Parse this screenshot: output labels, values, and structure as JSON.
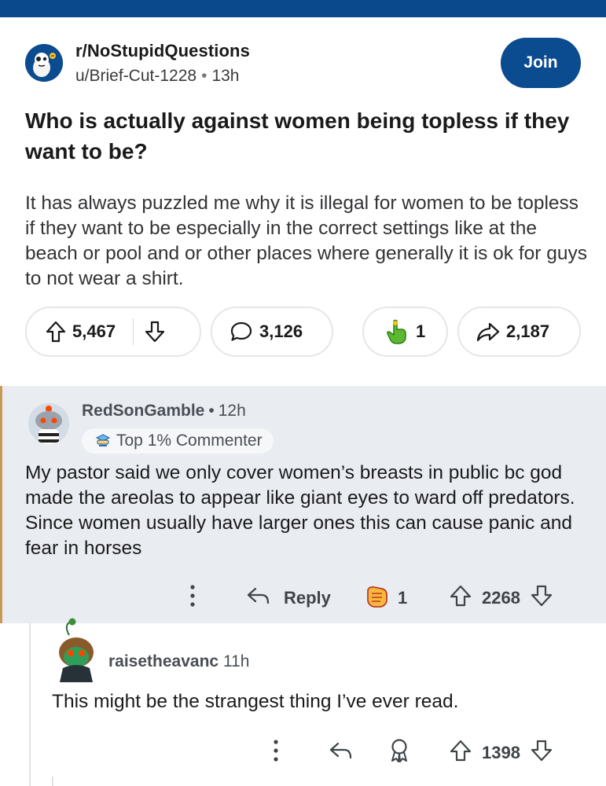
{
  "post": {
    "subreddit": "r/NoStupidQuestions",
    "author": "u/Brief-Cut-1228",
    "age": "13h",
    "join_label": "Join",
    "title": "Who is actually against women being topless if they want to be?",
    "body": "It has always puzzled me why it is illegal for women to be topless if they want to be especially in the correct settings like at the beach or pool and or other places where generally it is ok for guys to not wear a shirt.",
    "upvotes": "5,467",
    "comments": "3,126",
    "awards": "1",
    "shares": "2,187"
  },
  "comments": [
    {
      "username": "RedSonGamble",
      "age": "12h",
      "badge": "Top 1% Commenter",
      "text": "My pastor said we only cover women’s breasts in public bc god made the areolas to appear like giant eyes to ward off predators. Since women usually have larger ones this can cause panic and fear in horses",
      "reply_label": "Reply",
      "awards": "1",
      "score": "2268"
    },
    {
      "username": "raisetheavanc",
      "age": "11h",
      "text": "This might be the strangest thing I’ve ever read.",
      "score": "1398"
    }
  ],
  "icons": {
    "upvote": "arrow-up-icon",
    "downvote": "arrow-down-icon",
    "comment": "speech-bubble-icon",
    "award": "hand-award-icon",
    "share": "share-arrow-icon",
    "more": "vertical-dots-icon",
    "reply": "reply-arrow-icon"
  },
  "colors": {
    "brand": "#0b4b8f",
    "comment_highlight": "#e9edf2",
    "highlight_bar": "#c99a55"
  }
}
